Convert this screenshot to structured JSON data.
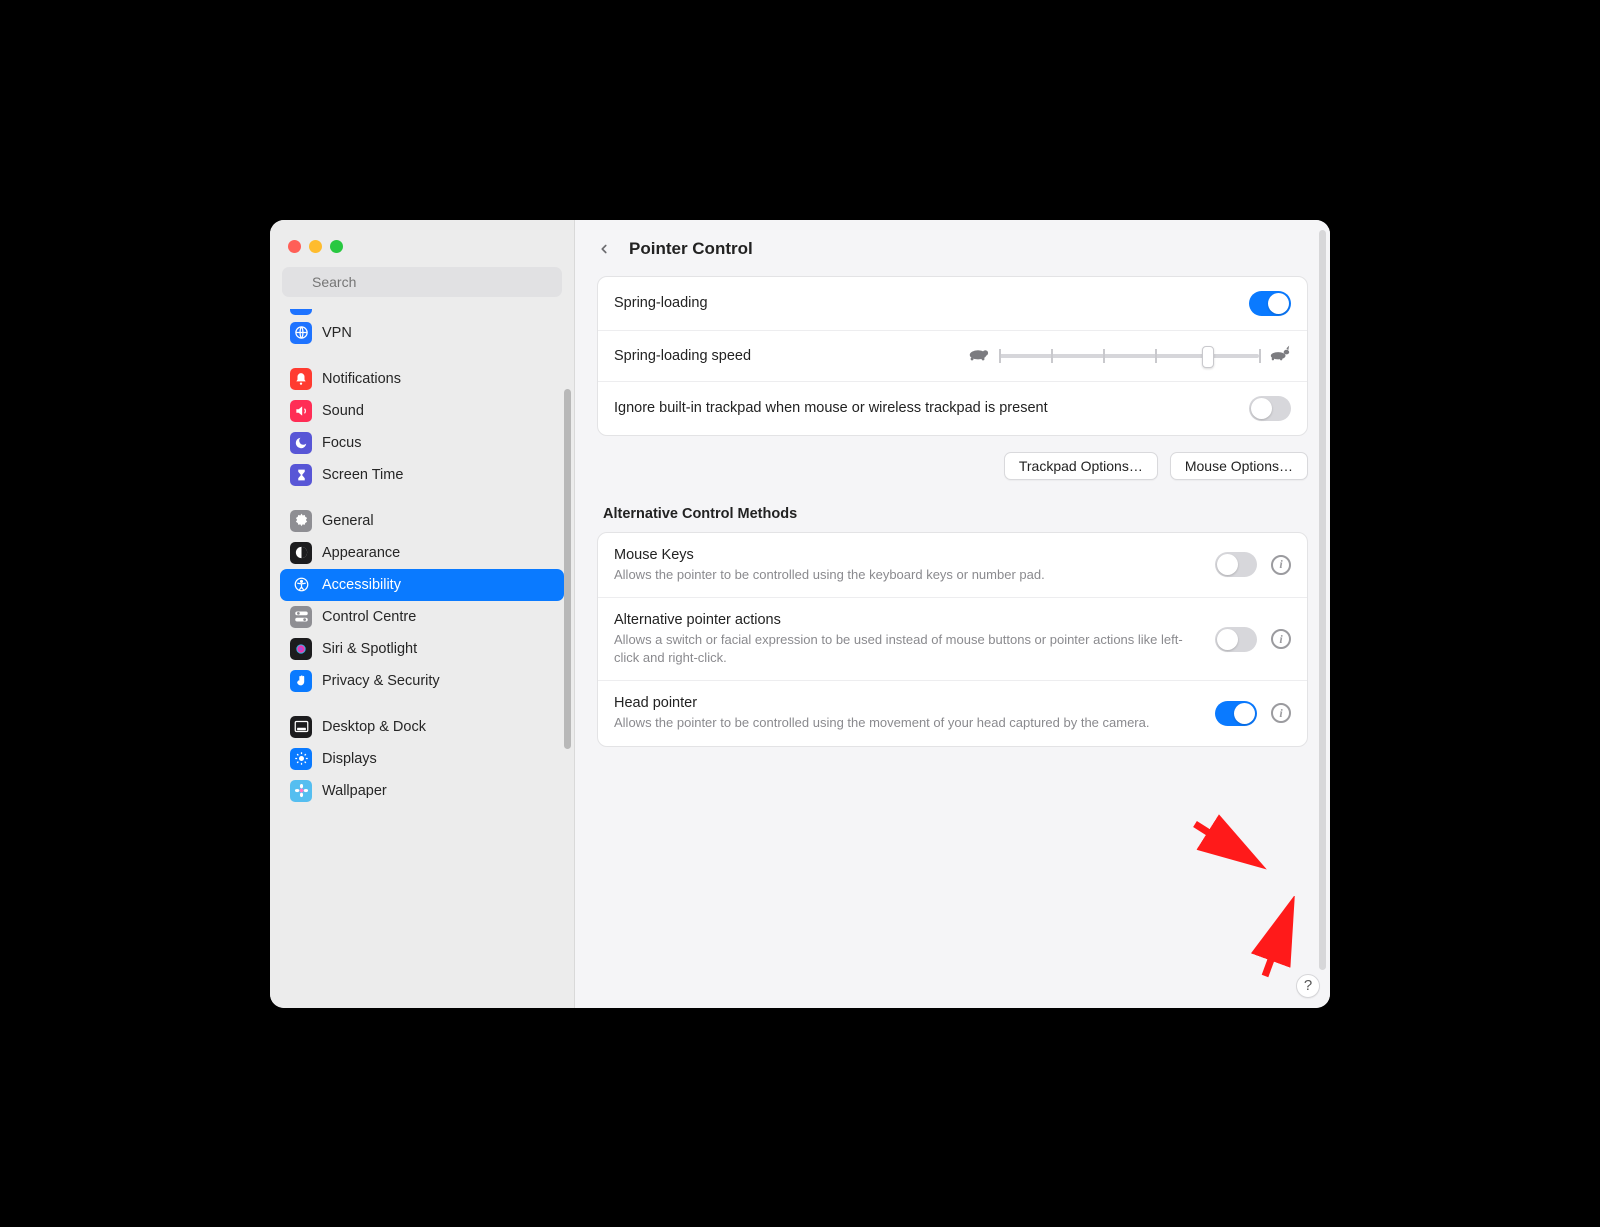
{
  "search": {
    "placeholder": "Search"
  },
  "header": {
    "title": "Pointer Control"
  },
  "sidebar": {
    "items": [
      {
        "label": "VPN",
        "iconBg": "#1e73ff",
        "glyph": "globe"
      },
      {
        "label": "Notifications",
        "iconBg": "#ff3b30",
        "glyph": "bell"
      },
      {
        "label": "Sound",
        "iconBg": "#ff2d55",
        "glyph": "speaker"
      },
      {
        "label": "Focus",
        "iconBg": "#5856d6",
        "glyph": "moon"
      },
      {
        "label": "Screen Time",
        "iconBg": "#5856d6",
        "glyph": "hourglass"
      },
      {
        "label": "General",
        "iconBg": "#8e8e93",
        "glyph": "gear"
      },
      {
        "label": "Appearance",
        "iconBg": "#1c1c1e",
        "glyph": "contrast"
      },
      {
        "label": "Accessibility",
        "iconBg": "#0a7aff",
        "glyph": "accessibility",
        "selected": true
      },
      {
        "label": "Control Centre",
        "iconBg": "#8e8e93",
        "glyph": "switches"
      },
      {
        "label": "Siri & Spotlight",
        "iconBg": "#1c1c1e",
        "glyph": "siri"
      },
      {
        "label": "Privacy & Security",
        "iconBg": "#0a7aff",
        "glyph": "hand"
      },
      {
        "label": "Desktop & Dock",
        "iconBg": "#1c1c1e",
        "glyph": "dock"
      },
      {
        "label": "Displays",
        "iconBg": "#0a7aff",
        "glyph": "sun"
      },
      {
        "label": "Wallpaper",
        "iconBg": "#55bef0",
        "glyph": "flower"
      }
    ]
  },
  "topCard": {
    "springLoading": {
      "label": "Spring-loading",
      "on": true
    },
    "springSpeed": {
      "label": "Spring-loading speed",
      "value": 0.78
    },
    "ignoreTrackpad": {
      "label": "Ignore built-in trackpad when mouse or wireless trackpad is present",
      "on": false
    }
  },
  "buttons": {
    "trackpad": "Trackpad Options…",
    "mouse": "Mouse Options…"
  },
  "altSection": {
    "heading": "Alternative Control Methods",
    "mouseKeys": {
      "title": "Mouse Keys",
      "desc": "Allows the pointer to be controlled using the keyboard keys or number pad.",
      "on": false
    },
    "altActions": {
      "title": "Alternative pointer actions",
      "desc": "Allows a switch or facial expression to be used instead of mouse buttons or pointer actions like left-click and right-click.",
      "on": false
    },
    "headPointer": {
      "title": "Head pointer",
      "desc": "Allows the pointer to be controlled using the movement of your head captured by the camera.",
      "on": true
    }
  },
  "help": "?"
}
